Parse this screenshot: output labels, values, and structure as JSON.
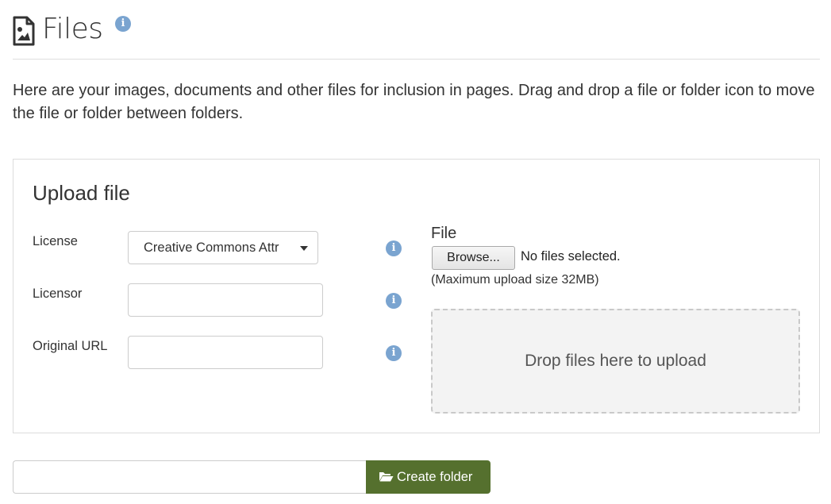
{
  "header": {
    "title": "Files",
    "title_icon": "file-image-icon",
    "info_icon": "info-icon"
  },
  "intro_text": "Here are your images, documents and other files for inclusion in pages. Drag and drop a file or folder icon to move the file or folder between folders.",
  "upload": {
    "title": "Upload file",
    "license_label": "License",
    "license_value": "Creative Commons Attr",
    "licensor_label": "Licensor",
    "licensor_value": "",
    "original_url_label": "Original URL",
    "original_url_value": "",
    "file_label": "File",
    "browse_label": "Browse...",
    "no_files_text": "No files selected.",
    "max_size_text": "(Maximum upload size 32MB)",
    "drop_zone_text": "Drop files here to upload"
  },
  "folder": {
    "input_value": "",
    "create_label": "Create folder",
    "create_icon": "folder-open-icon"
  },
  "colors": {
    "accent_green": "#55702e",
    "info_blue": "#7aa4d0",
    "drop_zone_bg": "#f3f3f3"
  }
}
